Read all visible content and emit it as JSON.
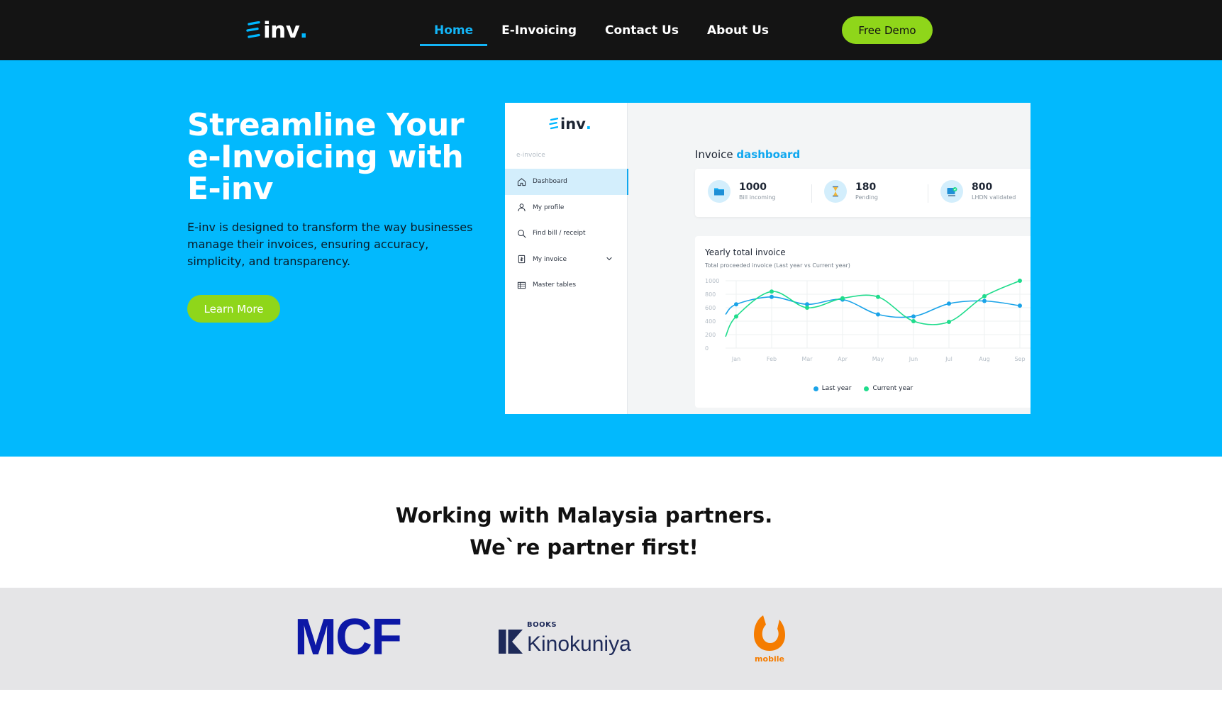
{
  "nav": {
    "brand": "inv",
    "brand_dot": ".",
    "links": [
      "Home",
      "E-Invoicing",
      "Contact Us",
      "About Us"
    ],
    "active": "Home",
    "cta_label": "Free Demo"
  },
  "hero": {
    "title_lines": [
      "Streamline Your",
      "e-Invoicing with",
      "E-inv"
    ],
    "description": "E-inv is designed to transform the way businesses manage their invoices, ensuring accuracy, simplicity, and transparency.",
    "cta_label": "Learn More"
  },
  "dashboard": {
    "brand": "inv",
    "brand_dot": ".",
    "section_label": "e-invoice",
    "menu": [
      {
        "label": "Dashboard",
        "icon": "home-icon",
        "active": true
      },
      {
        "label": "My profile",
        "icon": "user-icon"
      },
      {
        "label": "Find bill / receipt",
        "icon": "search-icon"
      },
      {
        "label": "My invoice",
        "icon": "invoice-icon",
        "has_submenu": true
      },
      {
        "label": "Master tables",
        "icon": "table-icon"
      }
    ],
    "title_prefix": "Invoice",
    "title_accent": "dashboard",
    "stats": [
      {
        "value": "1000",
        "label": "Bill incoming",
        "icon": "folder-icon"
      },
      {
        "value": "180",
        "label": "Pending",
        "icon": "hourglass-icon"
      },
      {
        "value": "800",
        "label": "LHDN validated",
        "icon": "validated-icon"
      }
    ]
  },
  "chart_data": {
    "type": "line",
    "title": "Yearly total invoice",
    "subtitle": "Total proceeded invoice (Last year vs Current year)",
    "categories": [
      "Jan",
      "Feb",
      "Mar",
      "Apr",
      "May",
      "Jun",
      "Jul",
      "Aug",
      "Sep"
    ],
    "y_ticks": [
      0,
      200,
      400,
      600,
      800,
      1000
    ],
    "ylim": [
      0,
      1000
    ],
    "grid": true,
    "legend_position": "bottom",
    "series": [
      {
        "name": "Last year",
        "color": "#1aa3e8",
        "values": [
          650,
          760,
          650,
          720,
          500,
          470,
          660,
          700,
          630
        ]
      },
      {
        "name": "Current year",
        "color": "#1fdc8c",
        "values": [
          470,
          840,
          600,
          740,
          760,
          400,
          390,
          770,
          1000
        ]
      }
    ]
  },
  "partners": {
    "title_line1": "Working with Malaysia partners.",
    "title_line2": "We`re partner first!",
    "logos": [
      {
        "name": "MCF",
        "text": "MCF"
      },
      {
        "name": "Kinokuniya",
        "small_text": "BOOKS",
        "text": "Kinokuniya"
      },
      {
        "name": "U Mobile",
        "text": "mobile"
      }
    ]
  }
}
